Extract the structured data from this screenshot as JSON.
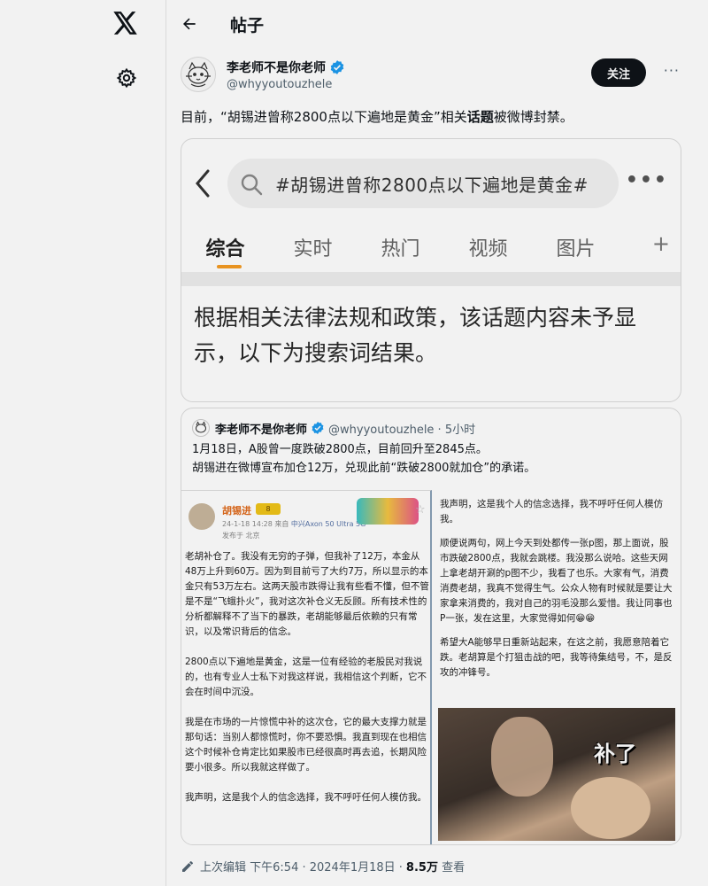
{
  "nav": {
    "logo_icon": "x-logo-icon",
    "settings_icon": "gear-icon"
  },
  "header": {
    "back_icon": "back-arrow-icon",
    "title": "帖子"
  },
  "post": {
    "author_name": "李老师不是你老师",
    "author_handle": "@whyyoutouzhele",
    "follow_label": "关注",
    "more_label": "···",
    "text_before": "目前，“胡锡进曾称2800点以下遍地是黄金”相关",
    "text_bold": "话题",
    "text_after": "被微博封禁。",
    "footer": {
      "edited_label": "上次编辑",
      "time": "下午6:54 · 2024年1月18日 ·",
      "views_count": "8.5万",
      "views_label": "查看"
    }
  },
  "weibo_card": {
    "search_query": "#胡锡进曾称2800点以下遍地是黄金#",
    "tabs": [
      "综合",
      "实时",
      "热门",
      "视频",
      "图片"
    ],
    "plus": "+",
    "notice": "根据相关法律法规和政策，该话题内容未予显示，以下为搜索词结果。"
  },
  "quote": {
    "author_name": "李老师不是你老师",
    "meta": "@whyyoutouzhele · 5小时",
    "text_line1": "1月18日，A股曾一度跌破2800点，目前回升至2845点。",
    "text_line2": "胡锡进在微博宣布加仓12万，兑现此前“跌破2800就加仓”的承诺。",
    "left_image": {
      "name": "胡锡进",
      "badge": "8",
      "date": "24-1-18 14:28",
      "source_prefix": "来自",
      "device": "中兴Axon 50 Ultra 5G",
      "location": "发布于 北京",
      "paragraphs": [
        "老胡补仓了。我没有无穷的子弹，但我补了12万，本金从48万上升到60万。因为到目前亏了大约7万，所以显示的本金只有53万左右。这两天股市跌得让我有些看不懂，但不管是不是“飞蛾扑火”，我对这次补仓义无反顾。所有技术性的分析都解释不了当下的暴跌，老胡能够最后依赖的只有常识，以及常识背后的信念。",
        "2800点以下遍地是黄金，这是一位有经验的老股民对我说的，也有专业人士私下对我这样说，我相信这个判断，它不会在时间中沉没。",
        "我是在市场的一片惊慌中补的这次仓，它的最大支撑力就是那句话：当别人都惊慌时，你不要恐惧。我直到现在也相信这个时候补仓肯定比如果股市已经很高时再去追，长期风险要小很多。所以我就这样做了。",
        "我声明，这是我个人的信念选择，我不呼吁任何人模仿我。"
      ]
    },
    "right_image": {
      "paragraphs": [
        "我声明，这是我个人的信念选择，我不呼吁任何人模仿我。",
        "顺便说两句，网上今天到处都传一张p图，那上面说，股市跌破2800点，我就会跳楼。我没那么说哈。这些天网上拿老胡开涮的p图不少，我看了也乐。大家有气，消费消费老胡，我真不觉得生气。公众人物有时候就是要让大家拿来消费的，我对自己的羽毛没那么爱惜。我让同事也P一张，发在这里，大家觉得如何😁😁",
        "希望大A能够早日重新站起来，在这之前，我愿意陪着它跌。老胡算是个打狙击战的吧，我等待集结号，不，是反攻的冲锋号。"
      ],
      "meme_text": "补了"
    }
  }
}
